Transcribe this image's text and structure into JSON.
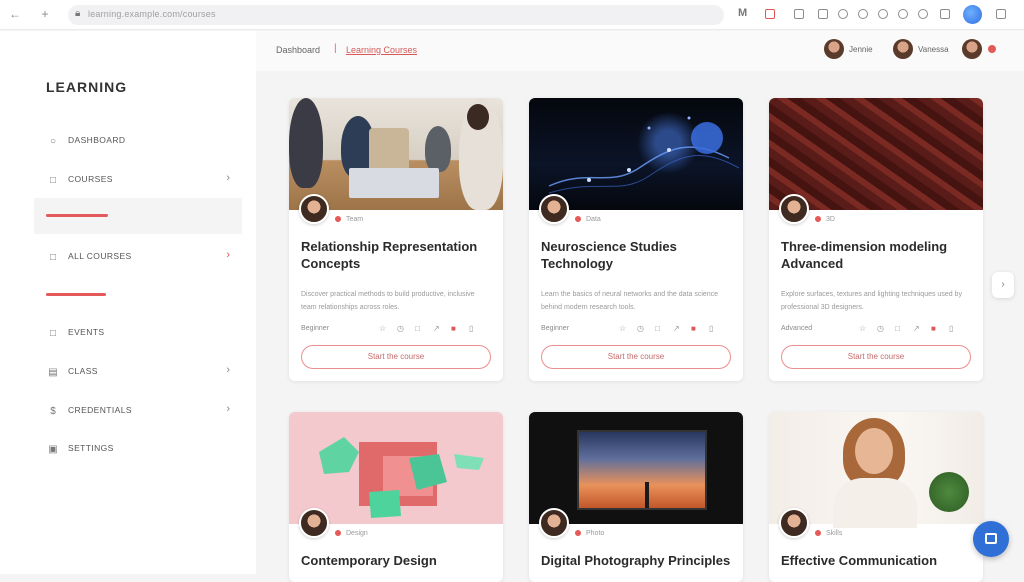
{
  "browser": {
    "url": "learning.example.com/courses",
    "ext_letter": "M"
  },
  "sidebar": {
    "brand": "LEARNING",
    "items": [
      {
        "label": "DASHBOARD",
        "icon": "circle-icon"
      },
      {
        "label": "COURSES",
        "icon": "book-icon",
        "has_chevron": true
      },
      {
        "label": "ALL COURSES",
        "icon": "grid-icon",
        "has_chevron": true
      },
      {
        "label": "EVENTS",
        "icon": "calendar-icon"
      },
      {
        "label": "CLASS",
        "icon": "document-icon",
        "has_chevron": true
      },
      {
        "label": "CREDENTIALS",
        "icon": "dollar-icon",
        "has_chevron": true
      },
      {
        "label": "SETTINGS",
        "icon": "gear-icon"
      }
    ]
  },
  "header": {
    "breadcrumb_home": "Dashboard",
    "breadcrumb_sep": "|",
    "breadcrumb_current": "Learning Courses",
    "users": [
      {
        "name": "Jennie"
      },
      {
        "name": "Vanessa"
      }
    ]
  },
  "cards": [
    {
      "meta": "Team",
      "title": "Relationship Representation Concepts",
      "desc": "Discover practical methods to build productive, inclusive team relationships across roles.",
      "footer_label": "Beginner",
      "button": "Start the course"
    },
    {
      "meta": "Data",
      "title": "Neuroscience Studies Technology",
      "desc": "Learn the basics of neural networks and the data science behind modern research tools.",
      "footer_label": "Beginner",
      "button": "Start the course"
    },
    {
      "meta": "3D",
      "title": "Three-dimension modeling Advanced",
      "desc": "Explore surfaces, textures and lighting techniques used by professional 3D designers.",
      "footer_label": "Advanced",
      "button": "Start the course"
    },
    {
      "meta": "Design",
      "title": "Contemporary Design",
      "desc": "",
      "footer_label": "",
      "button": ""
    },
    {
      "meta": "Photo",
      "title": "Digital Photography Principles",
      "desc": "",
      "footer_label": "",
      "button": ""
    },
    {
      "meta": "Skills",
      "title": "Effective Communication",
      "desc": "",
      "footer_label": "",
      "button": ""
    }
  ],
  "colors": {
    "accent": "#e45a5a",
    "fab": "#2f6fd6"
  }
}
